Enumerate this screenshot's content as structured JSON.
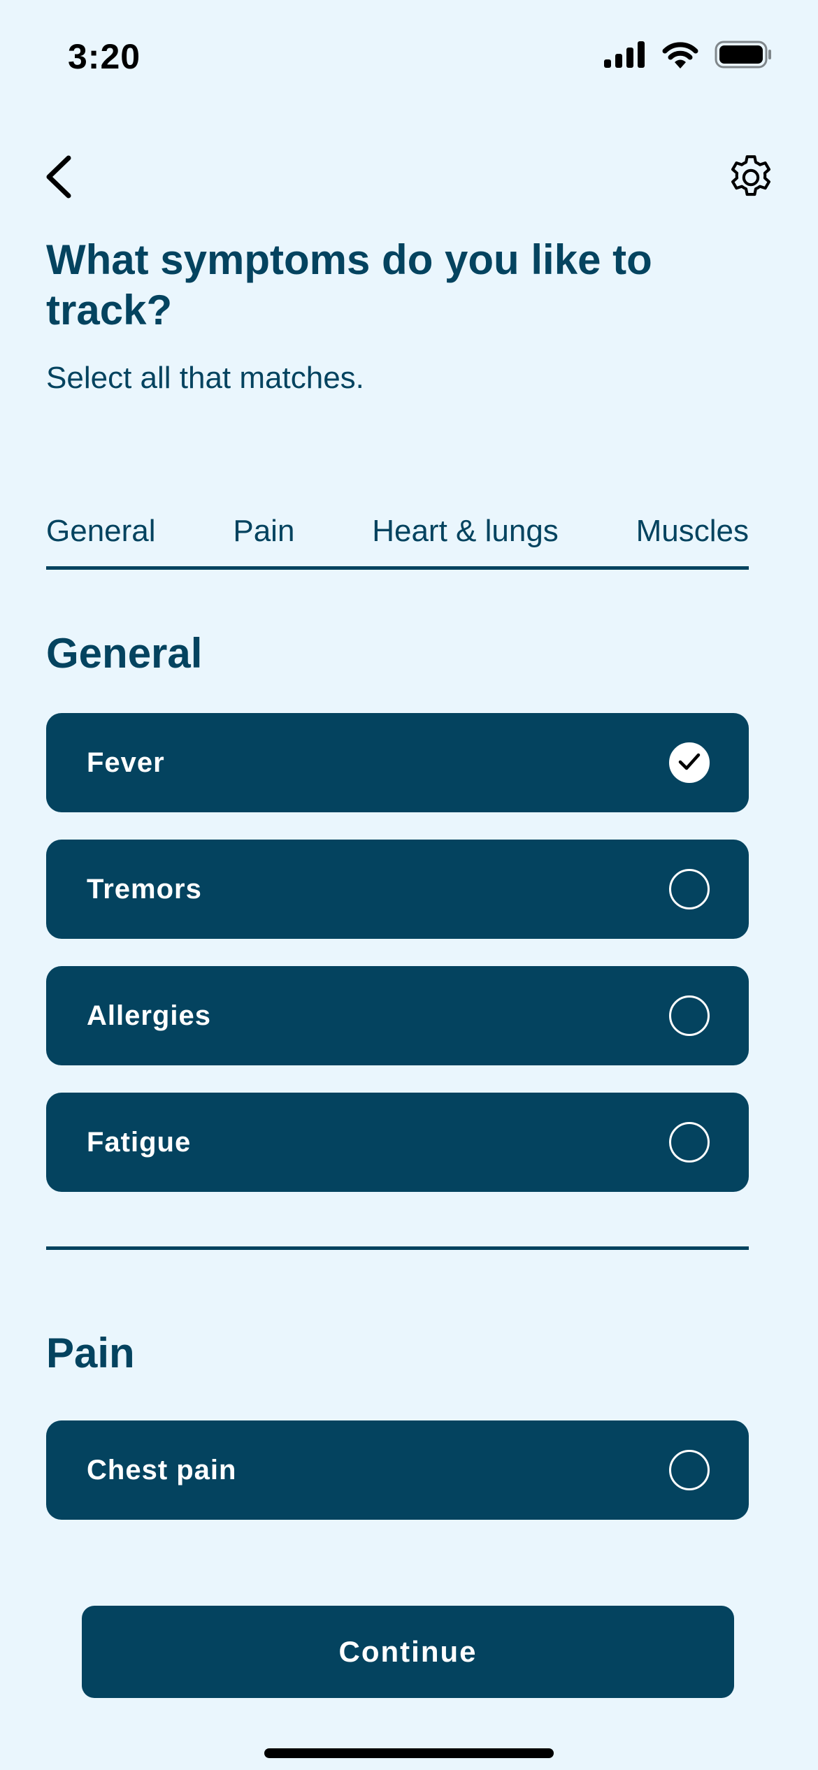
{
  "status_bar": {
    "time": "3:20"
  },
  "header": {
    "title": "What symptoms do you like to track?",
    "subtitle": "Select all that matches."
  },
  "tabs": [
    {
      "label": "General"
    },
    {
      "label": "Pain"
    },
    {
      "label": "Heart & lungs"
    },
    {
      "label": "Muscles"
    }
  ],
  "sections": {
    "general": {
      "title": "General",
      "options": [
        {
          "label": "Fever",
          "selected": true
        },
        {
          "label": "Tremors",
          "selected": false
        },
        {
          "label": "Allergies",
          "selected": false
        },
        {
          "label": "Fatigue",
          "selected": false
        }
      ]
    },
    "pain": {
      "title": "Pain",
      "options": [
        {
          "label": "Chest pain",
          "selected": false
        }
      ]
    }
  },
  "continue_label": "Continue",
  "icons": {
    "back": "chevron-left-icon",
    "settings": "gear-icon",
    "check": "checkmark-icon"
  },
  "colors": {
    "background": "#EAF6FD",
    "primary": "#04435F",
    "on_primary": "#FFFFFF"
  }
}
